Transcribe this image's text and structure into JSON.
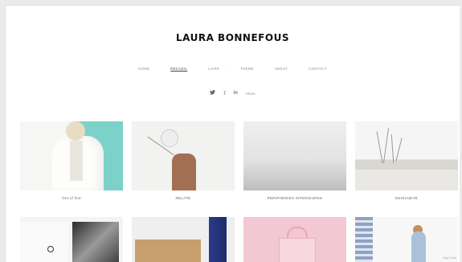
{
  "site": {
    "title": "LAURA BONNEFOUS"
  },
  "nav": {
    "items": [
      {
        "label": "HOME",
        "active": false
      },
      {
        "label": "RECUEIL",
        "active": true
      },
      {
        "label": "LIVRE",
        "active": false
      },
      {
        "label": "THEME",
        "active": false
      },
      {
        "label": "ABOUT",
        "active": false
      },
      {
        "label": "CONTACT",
        "active": false
      }
    ]
  },
  "social": {
    "twitter_icon": "t",
    "facebook_icon": "f",
    "linkedin_icon": "in",
    "share_label": "Share"
  },
  "gallery": {
    "row1": [
      {
        "caption": "Out of line"
      },
      {
        "caption": "RELATE"
      },
      {
        "caption": "PERIPHERIES INTERIEURES"
      },
      {
        "caption": "DESHABITE"
      }
    ]
  },
  "watermark": "blog Pavia"
}
